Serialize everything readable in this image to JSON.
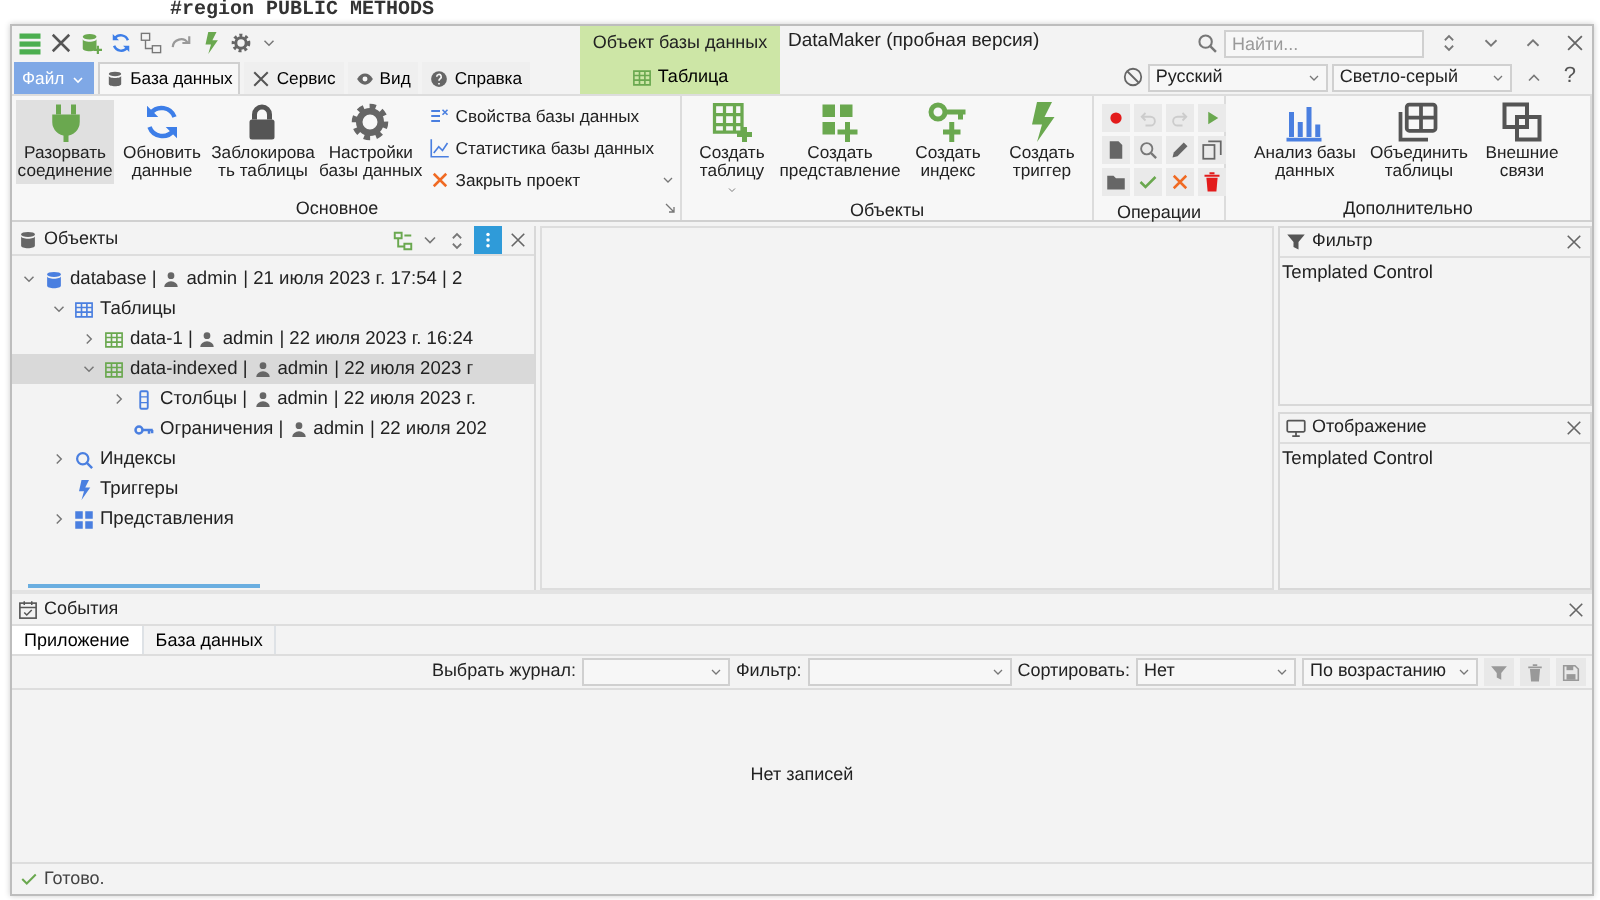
{
  "background_editor": {
    "code_line": "#region PUBLIC METHODS"
  },
  "window": {
    "title": "DataMaker (пробная версия)"
  },
  "contextual_tab_group": {
    "title": "Объект базы данных",
    "tabs": [
      {
        "label": "Таблица",
        "selected": false
      }
    ]
  },
  "ribbon_tabs": [
    {
      "label": "Файл",
      "kind": "backstage",
      "selected": false
    },
    {
      "label": "База данных",
      "kind": "tab",
      "selected": true
    },
    {
      "label": "Сервис",
      "kind": "tab",
      "selected": false
    },
    {
      "label": "Вид",
      "kind": "tab",
      "selected": false
    },
    {
      "label": "Справка",
      "kind": "tab",
      "selected": false
    }
  ],
  "search": {
    "placeholder": "Найти..."
  },
  "language_select": {
    "value": "Русский"
  },
  "theme_select": {
    "value": "Светло-серый"
  },
  "help_button": {
    "label": "?"
  },
  "ribbon_groups": [
    {
      "title": "Основное",
      "kind": "large",
      "buttons": [
        {
          "lines": [
            "Разорвать",
            "соединение"
          ],
          "pressed": true,
          "has_dropdown": false
        },
        {
          "lines": [
            "Обновить",
            "данные"
          ],
          "pressed": false,
          "has_dropdown": false
        },
        {
          "lines": [
            "Заблокирова",
            "ть таблицы"
          ],
          "pressed": false,
          "has_dropdown": false
        },
        {
          "lines": [
            "Настройки",
            "базы данных"
          ],
          "pressed": false,
          "has_dropdown": false
        }
      ],
      "small_buttons": [
        {
          "label": "Свойства базы данных"
        },
        {
          "label": "Статистика базы данных"
        },
        {
          "label": "Закрыть проект"
        }
      ]
    },
    {
      "title": "Объекты",
      "kind": "large",
      "buttons": [
        {
          "lines": [
            "Создать",
            "таблицу"
          ],
          "pressed": false,
          "has_dropdown": true
        },
        {
          "lines": [
            "Создать",
            "представление"
          ],
          "pressed": false,
          "has_dropdown": false
        },
        {
          "lines": [
            "Создать",
            "индекс"
          ],
          "pressed": false,
          "has_dropdown": false
        },
        {
          "lines": [
            "Создать",
            "триггер"
          ],
          "pressed": false,
          "has_dropdown": false
        }
      ]
    },
    {
      "title": "Операции",
      "kind": "grid",
      "buttons": [
        {
          "disabled": false
        },
        {
          "disabled": true
        },
        {
          "disabled": true
        },
        {
          "disabled": false
        },
        {
          "disabled": false
        },
        {
          "disabled": false
        },
        {
          "disabled": false
        },
        {
          "disabled": false
        },
        {
          "disabled": false
        },
        {
          "disabled": false
        },
        {
          "disabled": false
        },
        {
          "disabled": false
        }
      ]
    },
    {
      "title": "Дополнительно",
      "kind": "large",
      "buttons": [
        {
          "lines": [
            "Анализ базы",
            "данных"
          ],
          "pressed": false,
          "has_dropdown": false
        },
        {
          "lines": [
            "Объединить",
            "таблицы"
          ],
          "pressed": false,
          "has_dropdown": false
        },
        {
          "lines": [
            "Внешние",
            "связи"
          ],
          "pressed": false,
          "has_dropdown": false
        }
      ]
    }
  ],
  "objects_panel": {
    "title": "Объекты",
    "tree": [
      {
        "kind": "database",
        "name": "database |",
        "user": "admin",
        "info": "| 21 июля 2023 г. 17:54 | 2",
        "expanded": true,
        "selected": false,
        "children": [
          {
            "kind": "tables",
            "name": "Таблицы",
            "expanded": true,
            "selected": false,
            "children": [
              {
                "kind": "table",
                "name": "data-1 |",
                "user": "admin",
                "info": "| 22 июля 2023 г. 16:24",
                "expanded": false,
                "selected": false
              },
              {
                "kind": "table",
                "name": "data-indexed |",
                "user": "admin",
                "info": "| 22 июля 2023 г",
                "expanded": true,
                "selected": true,
                "children": [
                  {
                    "kind": "columns",
                    "name": "Столбцы |",
                    "user": "admin",
                    "info": "| 22 июля 2023 г.",
                    "expanded": false,
                    "selected": false
                  },
                  {
                    "kind": "key",
                    "name": "Ограничения |",
                    "user": "admin",
                    "info": "| 22 июля 202",
                    "selected": false
                  }
                ]
              }
            ]
          },
          {
            "kind": "index",
            "name": "Индексы",
            "expanded": false,
            "selected": false
          },
          {
            "kind": "trigger",
            "name": "Триггеры",
            "selected": false
          },
          {
            "kind": "views",
            "name": "Представления",
            "expanded": false,
            "selected": false
          }
        ]
      }
    ]
  },
  "filter_panel": {
    "title": "Фильтр",
    "content": "Templated Control"
  },
  "display_panel": {
    "title": "Отображение",
    "content": "Templated Control"
  },
  "events_panel": {
    "title": "События",
    "tabs": [
      {
        "label": "Приложение",
        "selected": true
      },
      {
        "label": "База данных",
        "selected": false
      }
    ],
    "journal_label": "Выбрать журнал:",
    "filter_label": "Фильтр:",
    "sort_label": "Сортировать:",
    "sort_value": "Нет",
    "order_value": "По возрастанию",
    "empty_message": "Нет записей"
  },
  "status_bar": {
    "text": "Готово."
  }
}
